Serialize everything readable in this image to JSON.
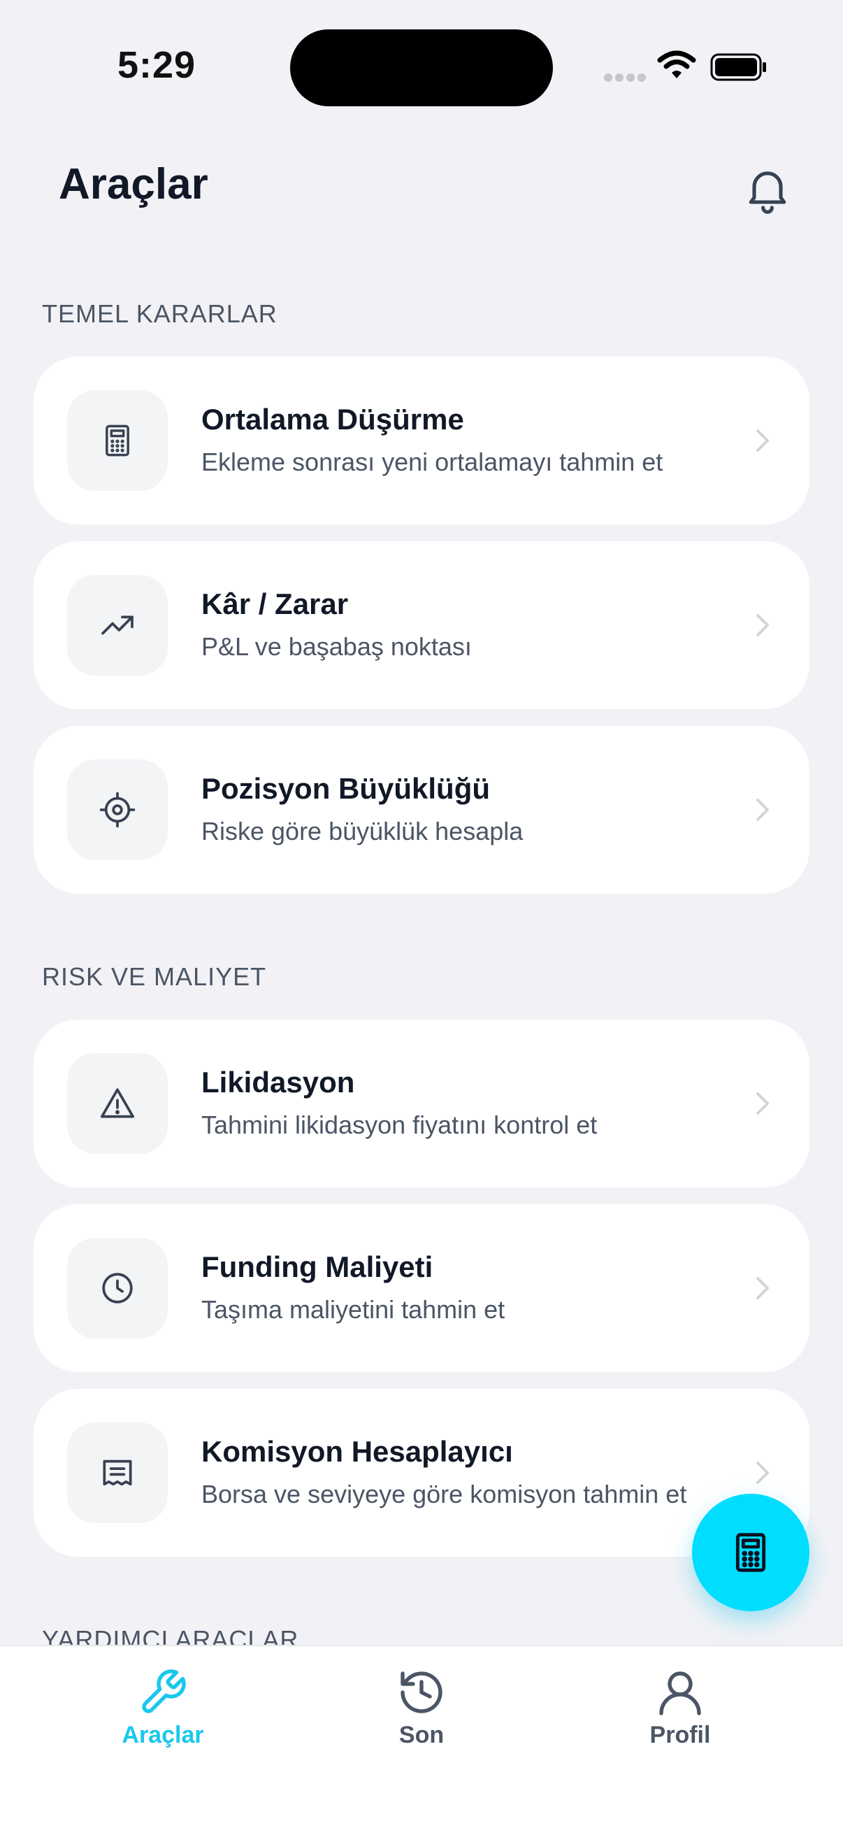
{
  "status_bar": {
    "time": "5:29"
  },
  "header": {
    "title": "Araçlar",
    "bell_icon": "bell-icon"
  },
  "sections": [
    {
      "title": "TEMEL KARARLAR",
      "items": [
        {
          "title": "Ortalama Düşürme",
          "subtitle": "Ekleme sonrası yeni ortalamayı tahmin et",
          "icon": "calculator-icon"
        },
        {
          "title": "Kâr / Zarar",
          "subtitle": "P&L ve başabaş noktası",
          "icon": "trending-up-icon"
        },
        {
          "title": "Pozisyon Büyüklüğü",
          "subtitle": "Riske göre büyüklük hesapla",
          "icon": "crosshair-icon"
        }
      ]
    },
    {
      "title": "RISK VE MALIYET",
      "items": [
        {
          "title": "Likidasyon",
          "subtitle": "Tahmini likidasyon fiyatını kontrol et",
          "icon": "warning-icon"
        },
        {
          "title": "Funding Maliyeti",
          "subtitle": "Taşıma maliyetini tahmin et",
          "icon": "clock-icon"
        },
        {
          "title": "Komisyon Hesaplayıcı",
          "subtitle": "Borsa ve seviyeye göre komisyon tahmin et",
          "icon": "receipt-icon"
        }
      ]
    },
    {
      "title": "YARDIMCI ARAÇLAR"
    }
  ],
  "fab": {
    "icon": "calculator-icon"
  },
  "tabbar": {
    "items": [
      {
        "label": "Araçlar",
        "icon": "wrench-icon",
        "active": true
      },
      {
        "label": "Son",
        "icon": "history-icon",
        "active": false
      },
      {
        "label": "Profil",
        "icon": "user-icon",
        "active": false
      }
    ]
  },
  "colors": {
    "accent": "#00ddff",
    "accent_text": "#18c8ec",
    "background": "#f2f2f6",
    "card": "#ffffff"
  }
}
